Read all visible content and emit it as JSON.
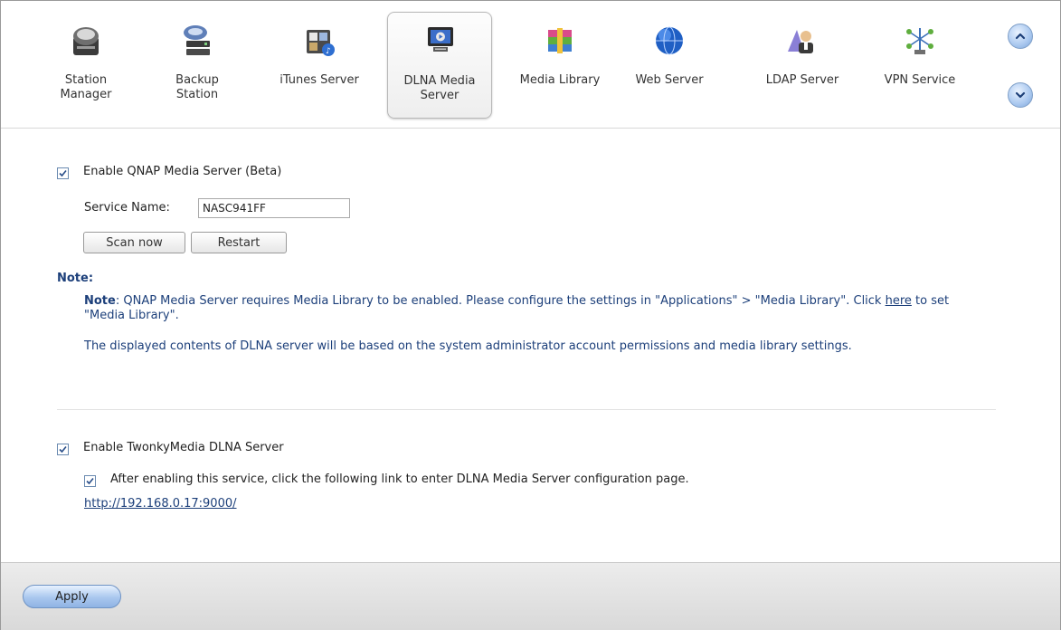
{
  "toolbar": {
    "items": [
      {
        "label": "Station\nManager",
        "icon": "station-manager-icon"
      },
      {
        "label": "Backup\nStation",
        "icon": "backup-station-icon"
      },
      {
        "label": "iTunes Server",
        "icon": "itunes-server-icon"
      },
      {
        "label": "DLNA Media\nServer",
        "icon": "dlna-media-server-icon",
        "active": true
      },
      {
        "label": "Media Library",
        "icon": "media-library-icon"
      },
      {
        "label": "Web Server",
        "icon": "web-server-icon"
      },
      {
        "label": "LDAP Server",
        "icon": "ldap-server-icon"
      },
      {
        "label": "VPN Service",
        "icon": "vpn-service-icon"
      }
    ],
    "scroll_up_icon": "chevron-up-icon",
    "scroll_down_icon": "chevron-down-icon"
  },
  "qnap": {
    "enable_label": "Enable QNAP Media Server (Beta)",
    "enabled": true,
    "service_name_label": "Service Name:",
    "service_name_value": "NASC941FF",
    "scan_label": "Scan now",
    "restart_label": "Restart"
  },
  "note": {
    "heading": "Note:",
    "line1_bold": "Note",
    "line1_text": ": QNAP Media Server requires Media Library to be enabled. Please configure the settings in \"Applications\" > \"Media Library\". Click ",
    "line1_link": "here",
    "line1_tail": " to set \"Media Library\".",
    "line2": "The displayed contents of DLNA server will be based on the system administrator account permissions and media library settings."
  },
  "twonky": {
    "enable_label": "Enable TwonkyMedia DLNA Server",
    "enabled": true,
    "sub_label": "After enabling this service, click the following link to enter DLNA Media Server configuration page.",
    "sub_enabled": true,
    "link": "http://192.168.0.17:9000/"
  },
  "footer": {
    "apply_label": "Apply"
  },
  "colors": {
    "note_text": "#1c3f7a",
    "accent_blue": "#8fb3e4"
  }
}
